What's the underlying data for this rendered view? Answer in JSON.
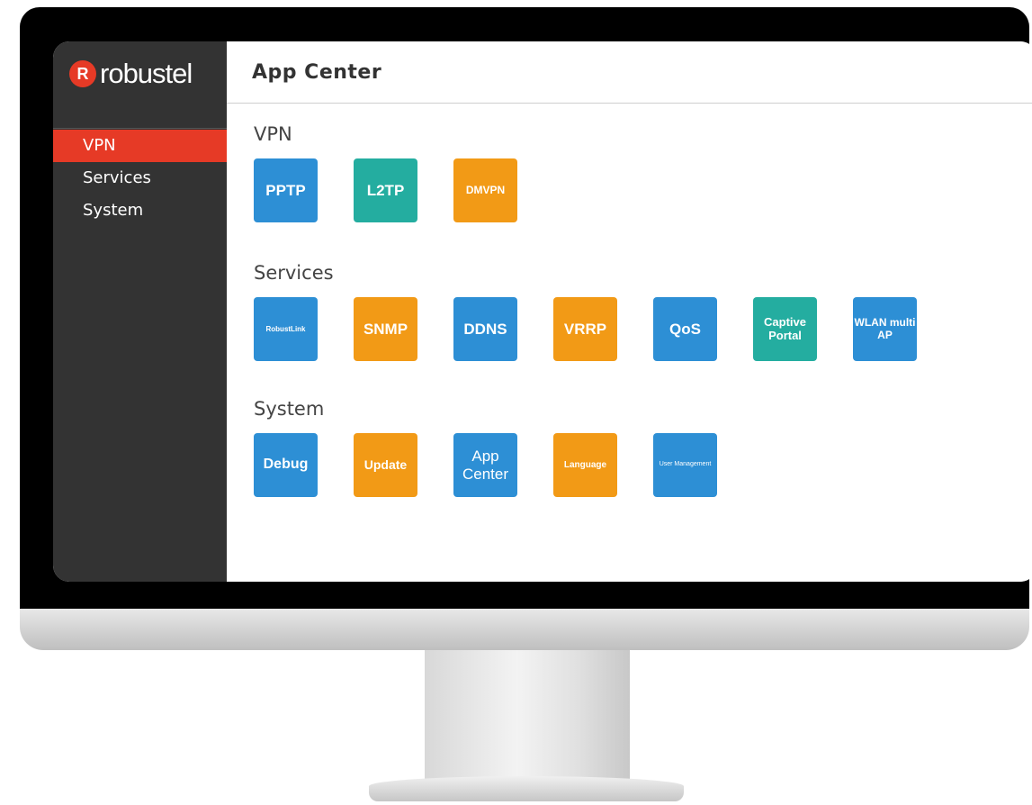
{
  "brand": {
    "logo_mark": "R",
    "logo_text": "robustel"
  },
  "sidebar": {
    "items": [
      {
        "label": "VPN",
        "active": true
      },
      {
        "label": "Services",
        "active": false
      },
      {
        "label": "System",
        "active": false
      }
    ]
  },
  "main": {
    "title": "App Center",
    "sections": [
      {
        "title": "VPN",
        "tiles": [
          {
            "label": "PPTP",
            "color": "blue"
          },
          {
            "label": "L2TP",
            "color": "teal"
          },
          {
            "label": "DMVPN",
            "color": "orange"
          }
        ]
      },
      {
        "title": "Services",
        "tiles": [
          {
            "label": "RobustLink",
            "color": "blue"
          },
          {
            "label": "SNMP",
            "color": "orange"
          },
          {
            "label": "DDNS",
            "color": "blue"
          },
          {
            "label": "VRRP",
            "color": "orange"
          },
          {
            "label": "QoS",
            "color": "blue"
          },
          {
            "label": "Captive Portal",
            "color": "teal"
          },
          {
            "label": "WLAN multi AP",
            "color": "blue"
          }
        ]
      },
      {
        "title": "System",
        "tiles": [
          {
            "label": "Debug",
            "color": "blue"
          },
          {
            "label": "Update",
            "color": "orange"
          },
          {
            "label": "App Center",
            "color": "blue"
          },
          {
            "label": "Language",
            "color": "orange"
          },
          {
            "label": "User Management",
            "color": "blue"
          }
        ]
      }
    ]
  },
  "colors": {
    "accent": "#e63a26",
    "blue": "#2d8fd5",
    "teal": "#24ada0",
    "orange": "#f29a16",
    "sidebar": "#333333"
  }
}
